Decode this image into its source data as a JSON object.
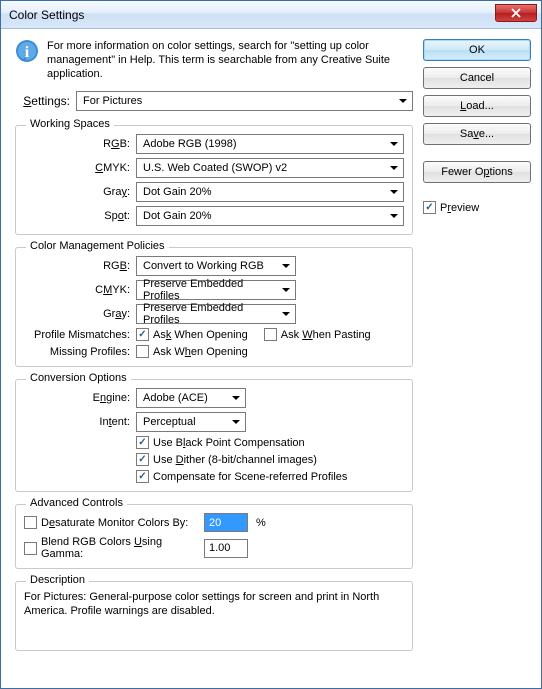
{
  "title": "Color Settings",
  "info_text": "For more information on color settings, search for \"setting up color management\" in Help. This term is searchable from any Creative Suite application.",
  "settings_label": "Settings:",
  "settings_value": "For Pictures",
  "buttons": {
    "ok": "OK",
    "cancel": "Cancel",
    "load": "Load...",
    "save": "Save...",
    "fewer_options": "Fewer Options"
  },
  "preview": {
    "label": "Preview",
    "checked": true
  },
  "working_spaces": {
    "legend": "Working Spaces",
    "rgb_label": "RGB:",
    "rgb_value": "Adobe RGB (1998)",
    "cmyk_label": "CMYK:",
    "cmyk_value": "U.S. Web Coated (SWOP) v2",
    "gray_label": "Gray:",
    "gray_value": "Dot Gain 20%",
    "spot_label": "Spot:",
    "spot_value": "Dot Gain 20%"
  },
  "policies": {
    "legend": "Color Management Policies",
    "rgb_label": "RGB:",
    "rgb_value": "Convert to Working RGB",
    "cmyk_label": "CMYK:",
    "cmyk_value": "Preserve Embedded Profiles",
    "gray_label": "Gray:",
    "gray_value": "Preserve Embedded Profiles",
    "profile_mismatches_label": "Profile Mismatches:",
    "ask_open_label": "Ask When Opening",
    "ask_open_checked": true,
    "ask_paste_label": "Ask When Pasting",
    "ask_paste_checked": false,
    "missing_profiles_label": "Missing Profiles:",
    "missing_ask_open_label": "Ask When Opening",
    "missing_ask_open_checked": false
  },
  "conversion": {
    "legend": "Conversion Options",
    "engine_label": "Engine:",
    "engine_value": "Adobe (ACE)",
    "intent_label": "Intent:",
    "intent_value": "Perceptual",
    "bpc_label": "Use Black Point Compensation",
    "bpc_checked": true,
    "dither_label": "Use Dither (8-bit/channel images)",
    "dither_checked": true,
    "scene_label": "Compensate for Scene-referred Profiles",
    "scene_checked": true
  },
  "advanced": {
    "legend": "Advanced Controls",
    "desat_label": "Desaturate Monitor Colors By:",
    "desat_checked": false,
    "desat_value": "20",
    "desat_unit": "%",
    "blend_label": "Blend RGB Colors Using Gamma:",
    "blend_checked": false,
    "blend_value": "1.00"
  },
  "description": {
    "legend": "Description",
    "text": "For Pictures:  General-purpose color settings for screen and print in North America. Profile warnings are disabled."
  }
}
